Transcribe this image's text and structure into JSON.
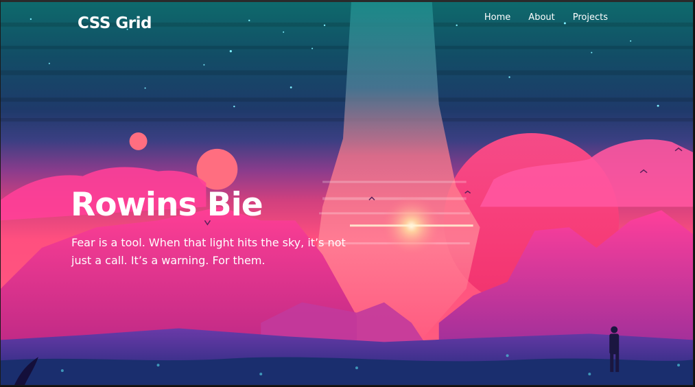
{
  "brand": {
    "name": "CSS Grid"
  },
  "nav": {
    "items": [
      {
        "label": "Home"
      },
      {
        "label": "About"
      },
      {
        "label": "Projects"
      }
    ]
  },
  "hero": {
    "title": "Rowins Bie",
    "subtitle": "Fear is a tool. When that light hits the sky, it’s not just a call. It’s a warning. For them."
  },
  "colors": {
    "sky_top": "#0d5f66",
    "sky_mid": "#1f3f6e",
    "horizon": "#ff3f8a",
    "mountain": "#e8247a",
    "ground": "#2a2a7a",
    "text": "#ffffff"
  }
}
